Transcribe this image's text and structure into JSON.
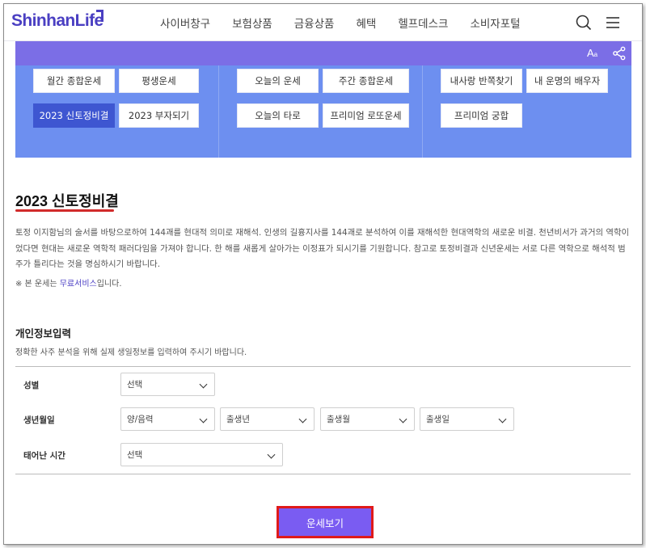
{
  "header": {
    "logo": "ShinhanLife",
    "nav": [
      "사이버창구",
      "보험상품",
      "금융상품",
      "혜택",
      "헬프데스크",
      "소비자포털"
    ],
    "icons": [
      "search-icon",
      "menu-icon"
    ]
  },
  "utilbar": {
    "font_label": "A",
    "font_label_small": "a",
    "share_icon": "share-icon"
  },
  "categories": {
    "col1": [
      "월간 종합운세",
      "평생운세",
      "2023 신토정비결",
      "2023 부자되기"
    ],
    "col2": [
      "오늘의 운세",
      "주간 종합운세",
      "오늘의 타로",
      "프리미엄 로또운세"
    ],
    "col3": [
      "내사랑 반쪽찾기",
      "내 운명의 배우자",
      "프리미엄 궁합"
    ],
    "active": "2023 신토정비결"
  },
  "content": {
    "title": "2023 신토정비결",
    "description": "토정 이지함님의 술서를 바탕으로하여 144괘를 현대적 의미로 재해석. 인생의 길흉지사를 144괘로 분석하여 이를 재해석한 현대역학의 새로운 비결. 천년비서가 과거의 역학이었다면 현대는 새로운 역학적 패러다임을 가져야 합니다. 한 해를 새롭게 살아가는 이정표가 되시기를 기원합니다. 참고로 토정비결과 신년운세는 서로 다른 역학으로 해석적 범주가 틀리다는 것을 명심하시기 바랍니다.",
    "note_prefix": "※ 본 운세는 ",
    "note_link": "무료서비스",
    "note_suffix": "입니다."
  },
  "form": {
    "section_title": "개인정보입력",
    "section_desc": "정확한 사주 분석을 위해 실제 생일정보를 입력하여 주시기 바랍니다.",
    "gender_label": "성별",
    "gender_value": "선택",
    "birth_label": "생년월일",
    "calendar_value": "양/음력",
    "year_value": "출생년",
    "month_value": "출생월",
    "day_value": "출생일",
    "time_label": "태어난 시간",
    "time_value": "선택"
  },
  "cta": {
    "label": "운세보기"
  },
  "colors": {
    "brand": "#4a3fc2",
    "util_bar": "#7b6ee6",
    "panel": "#6d8ff0",
    "active_button": "#3e56d1",
    "cta": "#7a5cf2",
    "highlight": "#e01a1a"
  }
}
